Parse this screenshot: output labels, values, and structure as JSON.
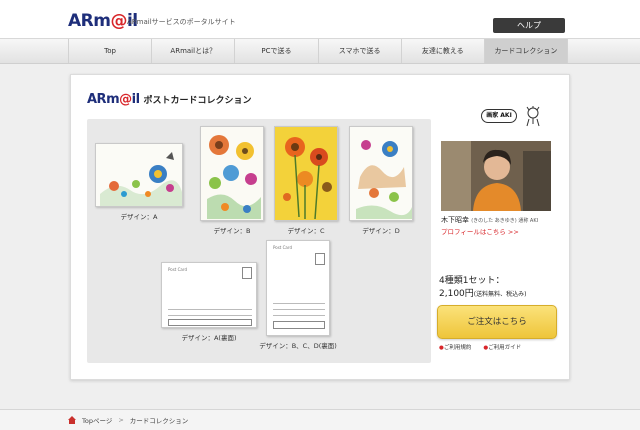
{
  "header": {
    "logo_main": "ARm",
    "logo_accent": "@",
    "logo_tail": "il",
    "tagline": "ARmailサービスのポータルサイト",
    "help_label": "ヘルプ"
  },
  "nav": {
    "items": [
      {
        "label": "Top"
      },
      {
        "label": "ARmailとは？"
      },
      {
        "label": "PCで送る"
      },
      {
        "label": "スマホで送る"
      },
      {
        "label": "友達に教える"
      },
      {
        "label": "カードコレクション"
      }
    ],
    "active_index": 5
  },
  "panel": {
    "logo_main": "ARm",
    "logo_accent": "@",
    "logo_tail": "il",
    "title": "ポストカードコレクション"
  },
  "gallery": {
    "cards": [
      {
        "label": "デザイン：A"
      },
      {
        "label": "デザイン：B"
      },
      {
        "label": "デザイン：C"
      },
      {
        "label": "デザイン：D"
      },
      {
        "label": "デザイン：A(裏面)"
      },
      {
        "label": "デザイン：B、C、D(裏面)"
      }
    ],
    "back_header": "Post Card"
  },
  "artist": {
    "badge": "画家 AKI",
    "name": "木下昭幸",
    "name_reading": "(きのした あきゆき) 通称 AKI",
    "profile_link": "プロフィールはこちら >>"
  },
  "purchase": {
    "line1": "4種類1セット：",
    "price": "2,100円",
    "price_note": "(送料無料、税込み)",
    "order_label": "ご注文はこちら",
    "guide_links": [
      "ご利用規約",
      "ご利用ガイド"
    ]
  },
  "breadcrumb": {
    "items": [
      "Topページ",
      "カードコレクション"
    ],
    "separator": ">"
  },
  "colors": {
    "brand_navy": "#1e2e7a",
    "brand_red": "#d8262a",
    "order_button": "#f3d14e",
    "card_c_bg": "#f3d23a"
  }
}
